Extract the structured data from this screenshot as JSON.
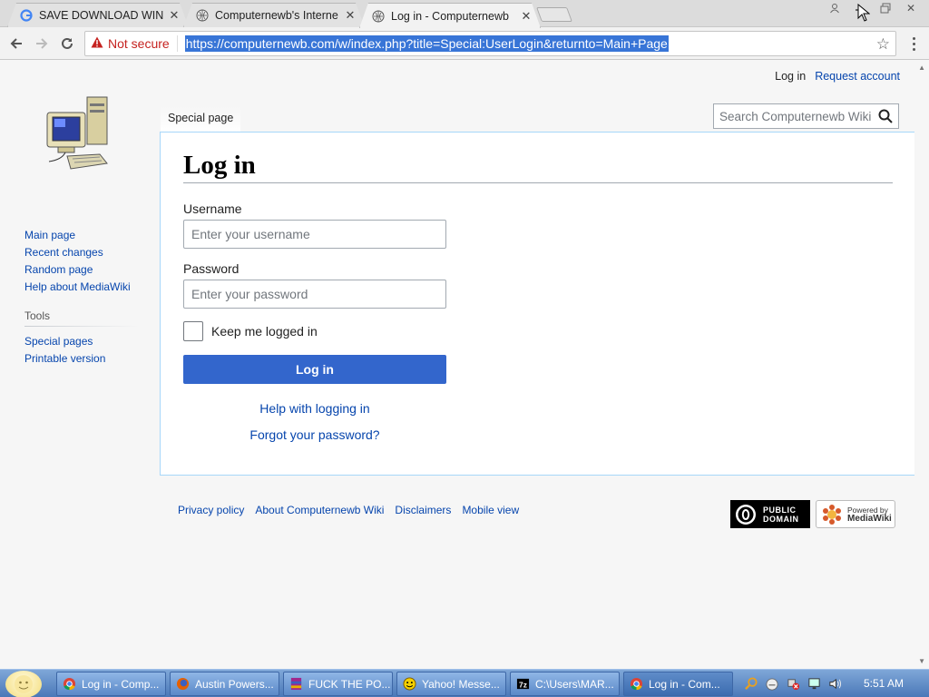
{
  "browser": {
    "tabs": [
      {
        "title": "SAVE DOWNLOAD WIND",
        "icon": "google-icon"
      },
      {
        "title": "Computernewb's Interne",
        "icon": "wiki-globe-icon"
      },
      {
        "title": "Log in - Computernewb",
        "icon": "wiki-globe-icon",
        "active": true
      }
    ],
    "security_label": "Not secure",
    "url": "https://computernewb.com/w/index.php?title=Special:UserLogin&returnto=Main+Page"
  },
  "personal_tools": {
    "login": "Log in",
    "request_account": "Request account"
  },
  "content_tab": "Special page",
  "search": {
    "placeholder": "Search Computernewb Wiki"
  },
  "sidebar": {
    "nav": [
      "Main page",
      "Recent changes",
      "Random page",
      "Help about MediaWiki"
    ],
    "tools_heading": "Tools",
    "tools": [
      "Special pages",
      "Printable version"
    ]
  },
  "login_form": {
    "heading": "Log in",
    "username_label": "Username",
    "username_placeholder": "Enter your username",
    "password_label": "Password",
    "password_placeholder": "Enter your password",
    "remember_label": "Keep me logged in",
    "submit_label": "Log in",
    "help_link": "Help with logging in",
    "forgot_link": "Forgot your password?"
  },
  "footer": {
    "links": [
      "Privacy policy",
      "About Computernewb Wiki",
      "Disclaimers",
      "Mobile view"
    ],
    "pd_badge": [
      "PUBLIC",
      "DOMAIN"
    ],
    "mw_badge": [
      "Powered by",
      "MediaWiki"
    ]
  },
  "taskbar": {
    "tasks": [
      {
        "label": "Log in - Comp...",
        "icon": "chrome-icon"
      },
      {
        "label": "Austin Powers...",
        "icon": "firefox-icon"
      },
      {
        "label": "FUCK THE  PO...",
        "icon": "winrar-icon"
      },
      {
        "label": "Yahoo! Messe...",
        "icon": "yahoo-messenger-icon"
      },
      {
        "label": "C:\\Users\\MAR...",
        "icon": "7zip-icon"
      },
      {
        "label": "Log in - Com...",
        "icon": "chrome-icon",
        "active": true
      }
    ],
    "clock": "5:51 AM"
  },
  "colors": {
    "link": "#0645ad",
    "button": "#3366cc",
    "content_border": "#a7d7f9",
    "warning": "#c5221f"
  }
}
